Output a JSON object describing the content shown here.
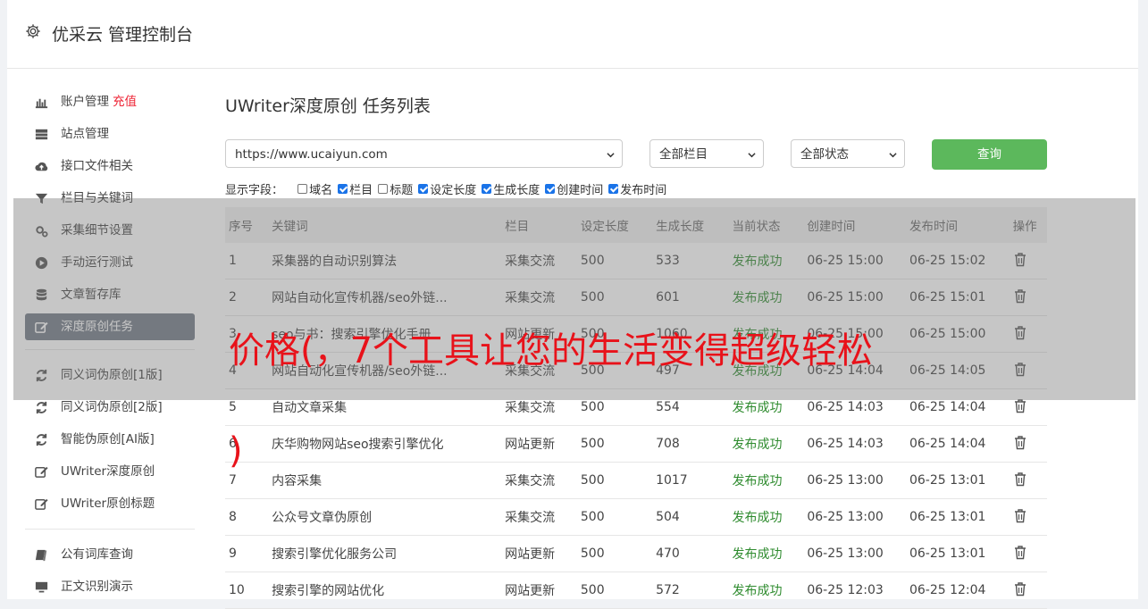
{
  "app": {
    "title": "优采云 管理控制台"
  },
  "sidebar": {
    "group1": [
      {
        "label": "账户管理",
        "extra": "充值",
        "icon": "bar-chart-icon"
      },
      {
        "label": "站点管理",
        "icon": "server-icon"
      },
      {
        "label": "接口文件相关",
        "icon": "cloud-upload-icon"
      },
      {
        "label": "栏目与关键词",
        "icon": "filter-icon"
      },
      {
        "label": "采集细节设置",
        "icon": "gears-icon"
      },
      {
        "label": "手动运行测试",
        "icon": "play-circle-icon"
      },
      {
        "label": "文章暂存库",
        "icon": "database-icon"
      },
      {
        "label": "深度原创任务",
        "icon": "edit-icon",
        "active": true
      }
    ],
    "group2": [
      {
        "label": "同义词伪原创[1版]",
        "icon": "refresh-icon"
      },
      {
        "label": "同义词伪原创[2版]",
        "icon": "refresh-icon"
      },
      {
        "label": "智能伪原创[AI版]",
        "icon": "refresh-icon"
      },
      {
        "label": "UWriter深度原创",
        "icon": "edit-icon"
      },
      {
        "label": "UWriter原创标题",
        "icon": "edit-icon"
      }
    ],
    "group3": [
      {
        "label": "公有词库查询",
        "icon": "book-icon"
      },
      {
        "label": "正文识别演示",
        "icon": "monitor-icon"
      }
    ]
  },
  "main": {
    "title": "UWriter深度原创 任务列表",
    "site_select": "https://www.ucaiyun.com",
    "column_select": "全部栏目",
    "status_select": "全部状态",
    "query_label": "查询",
    "fields_label": "显示字段：",
    "fields": [
      {
        "label": "域名",
        "checked": false
      },
      {
        "label": "栏目",
        "checked": true
      },
      {
        "label": "标题",
        "checked": false
      },
      {
        "label": "设定长度",
        "checked": true
      },
      {
        "label": "生成长度",
        "checked": true
      },
      {
        "label": "创建时间",
        "checked": true
      },
      {
        "label": "发布时间",
        "checked": true
      }
    ],
    "table": {
      "headers": [
        "序号",
        "关键词",
        "栏目",
        "设定长度",
        "生成长度",
        "当前状态",
        "创建时间",
        "发布时间",
        "操作"
      ],
      "rows": [
        [
          "1",
          "采集器的自动识别算法",
          "采集交流",
          "500",
          "533",
          "发布成功",
          "06-25 15:00",
          "06-25 15:02"
        ],
        [
          "2",
          "网站自动化宣传机器/seo外链...",
          "采集交流",
          "500",
          "601",
          "发布成功",
          "06-25 15:00",
          "06-25 15:01"
        ],
        [
          "3",
          "seo与书：搜索引擎优化手册",
          "网站更新",
          "500",
          "1060",
          "发布成功",
          "06-25 15:00",
          "06-25 15:00"
        ],
        [
          "4",
          "网站自动化宣传机器/seo外链...",
          "采集交流",
          "500",
          "497",
          "发布成功",
          "06-25 14:04",
          "06-25 14:05"
        ],
        [
          "5",
          "自动文章采集",
          "采集交流",
          "500",
          "554",
          "发布成功",
          "06-25 14:03",
          "06-25 14:04"
        ],
        [
          "6",
          "庆华购物网站seo搜索引擎优化",
          "网站更新",
          "500",
          "708",
          "发布成功",
          "06-25 14:03",
          "06-25 14:04"
        ],
        [
          "7",
          "内容采集",
          "采集交流",
          "500",
          "1017",
          "发布成功",
          "06-25 13:00",
          "06-25 13:01"
        ],
        [
          "8",
          "公众号文章伪原创",
          "采集交流",
          "500",
          "504",
          "发布成功",
          "06-25 13:00",
          "06-25 13:01"
        ],
        [
          "9",
          "搜索引擎优化服务公司",
          "网站更新",
          "500",
          "470",
          "发布成功",
          "06-25 13:00",
          "06-25 13:01"
        ],
        [
          "10",
          "搜索引擎的网站优化",
          "网站更新",
          "500",
          "572",
          "发布成功",
          "06-25 12:03",
          "06-25 12:04"
        ]
      ]
    }
  },
  "overlay": {
    "line1": "价格(，7个工具让您的生活变得超级轻松",
    "line2": ")"
  }
}
